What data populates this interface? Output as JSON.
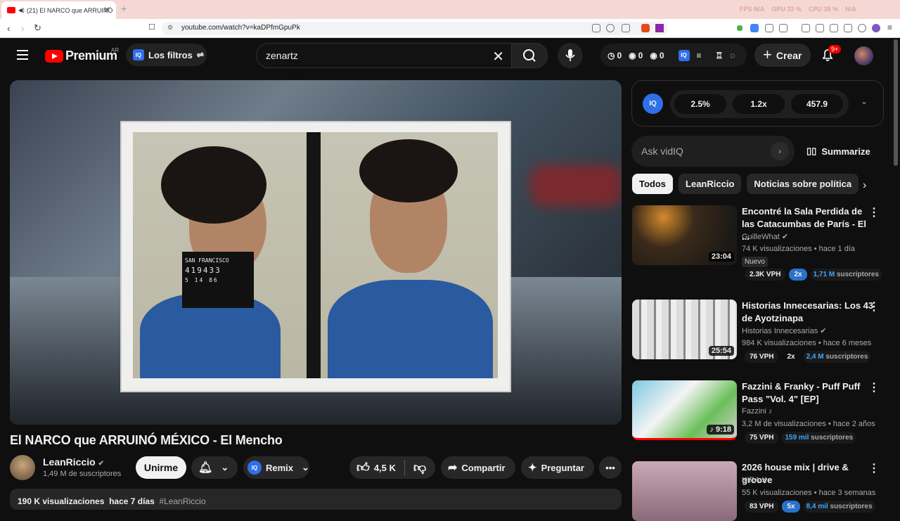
{
  "browser": {
    "tab_title": "(21) El NARCO que ARRUINÓ",
    "url": "youtube.com/watch?v=kaDPfmGpuPk",
    "sys_stats": [
      "FPS N/A",
      "GPU 33 %",
      "CPU 35 %",
      "N/A"
    ]
  },
  "header": {
    "logo_text": "Premium",
    "country": "AR",
    "filters_label": "Los filtros",
    "search_value": "zenartz",
    "stats": [
      "0",
      "0",
      "0"
    ],
    "create_label": "Crear",
    "notif_badge": "9+"
  },
  "video": {
    "title": "El NARCO que ARRUINÓ MÉXICO - El Mencho",
    "placard_lines": [
      "SAN FRANCISCO",
      "419433",
      "5  14  86"
    ],
    "channel": "LeanRiccio",
    "subscribers": "1,49 M de suscriptores",
    "join_label": "Unirme",
    "remix_label": "Remix",
    "likes": "4,5 K",
    "share_label": "Compartir",
    "ask_label": "Preguntar",
    "views": "190 K visualizaciones",
    "date": "hace 7 días",
    "hashtag": "#LeanRiccio"
  },
  "vidiq": {
    "stat1": "2.5%",
    "stat2": "1.2x",
    "stat3": "457.9",
    "ask_placeholder": "Ask vidIQ",
    "summarize_label": "Summarize"
  },
  "chips": [
    "Todos",
    "LeanRiccio",
    "Noticias sobre política"
  ],
  "recommendations": [
    {
      "title": "Encontré la Sala Perdida de las Catacumbas de París - El ...",
      "channel": "GuilleWhat",
      "meta": "74 K visualizaciones • hace 1 día",
      "badge": "Nuevo",
      "duration": "23:04",
      "vph": "2.3K VPH",
      "mult": "2x",
      "subs": "1,71 M",
      "subs_label": "suscriptores"
    },
    {
      "title": "Historias Innecesarias: Los 43 de Ayotzinapa",
      "channel": "Historias Innecesarias",
      "meta": "984 K visualizaciones • hace 6 meses",
      "duration": "25:54",
      "vph": "76 VPH",
      "mult": "2x",
      "subs": "2,4 M",
      "subs_label": "suscriptores"
    },
    {
      "title": "Fazzini & Franky - Puff Puff Pass \"Vol. 4\" [EP]",
      "channel": "Fazzini",
      "meta": "3,2 M de visualizaciones • hace 2 años",
      "duration": "9:18",
      "vph": "75 VPH",
      "subs": "159 mil",
      "subs_label": "suscriptores"
    },
    {
      "title": "2026 house mix | drive & groove",
      "channel": "KIRA X",
      "meta": "55 K visualizaciones • hace 3 semanas",
      "vph": "83 VPH",
      "mult": "5x",
      "subs": "8,4 mil",
      "subs_label": "suscriptores"
    }
  ],
  "icons": [
    "youtube-tab-icon",
    "back-icon",
    "forward-icon",
    "reload-icon",
    "search-icon",
    "mic-icon",
    "bell-icon",
    "like-icon",
    "dislike-icon",
    "share-icon",
    "sparkle-icon",
    "more-icon",
    "verified-icon",
    "book-icon"
  ]
}
